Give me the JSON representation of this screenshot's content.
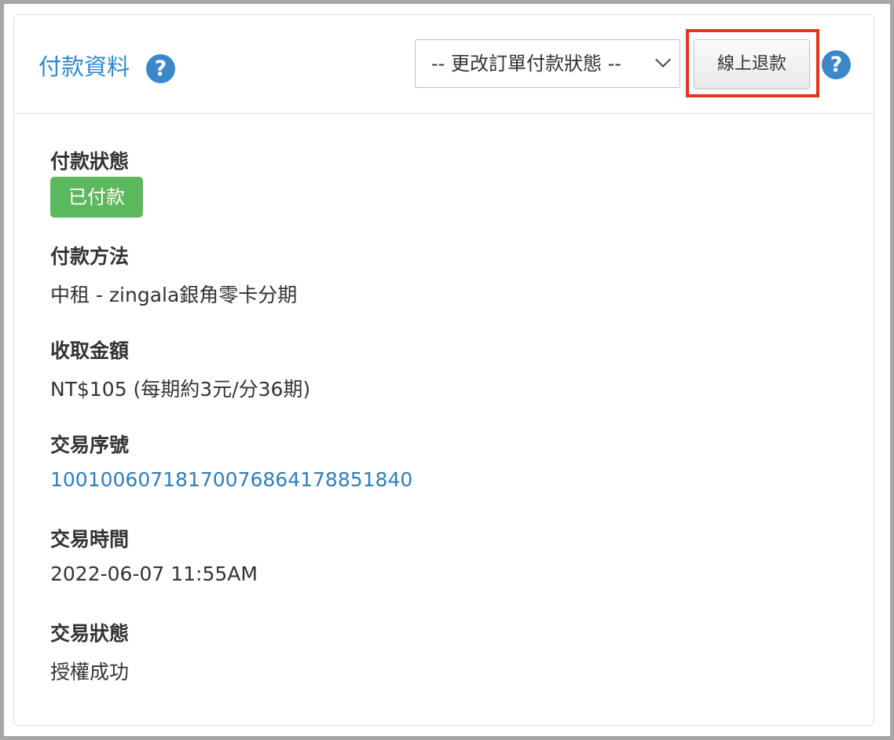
{
  "header": {
    "title": "付款資料",
    "status_select": "-- 更改訂單付款狀態 --",
    "refund_button": "線上退款",
    "help_glyph": "?"
  },
  "fields": {
    "payment_status": {
      "label": "付款狀態",
      "badge": "已付款"
    },
    "payment_method": {
      "label": "付款方法",
      "value": "中租 - zingala銀角零卡分期"
    },
    "amount": {
      "label": "收取金額",
      "value": "NT$105 (每期約3元/分36期)"
    },
    "transaction_id": {
      "label": "交易序號",
      "value": "100100607181700768641788518​40"
    },
    "transaction_time": {
      "label": "交易時間",
      "value": "2022-06-07 11:55AM"
    },
    "transaction_status": {
      "label": "交易狀態",
      "value": "授權成功"
    }
  },
  "colors": {
    "accent": "#2f8ac8",
    "success": "#5cb85c",
    "highlight": "#e8341c"
  }
}
